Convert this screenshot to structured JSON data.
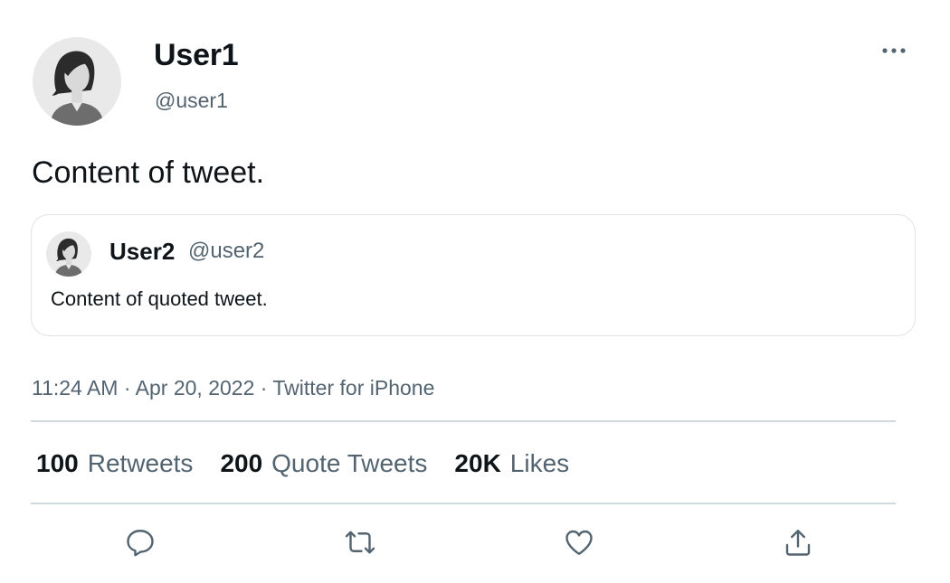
{
  "tweet": {
    "author": {
      "display_name": "User1",
      "handle": "@user1"
    },
    "text": "Content of tweet.",
    "timestamp": "11:24 AM",
    "date": "Apr 20, 2022",
    "source": "Twitter for iPhone",
    "separator": " · "
  },
  "quoted": {
    "author": {
      "display_name": "User2",
      "handle": "@user2"
    },
    "text": "Content of quoted tweet."
  },
  "stats": [
    {
      "value": "100",
      "label": "Retweets"
    },
    {
      "value": "200",
      "label": "Quote Tweets"
    },
    {
      "value": "20K",
      "label": "Likes"
    }
  ],
  "icons": {
    "avatar": "avatar-icon",
    "more": "more-dots-icon",
    "reply": "reply-icon",
    "retweet": "retweet-icon",
    "like": "heart-icon",
    "share": "share-icon"
  },
  "colors": {
    "text": "#0f1419",
    "secondary": "#536471",
    "border": "#dfe3e6",
    "divider": "#cfd9de"
  }
}
